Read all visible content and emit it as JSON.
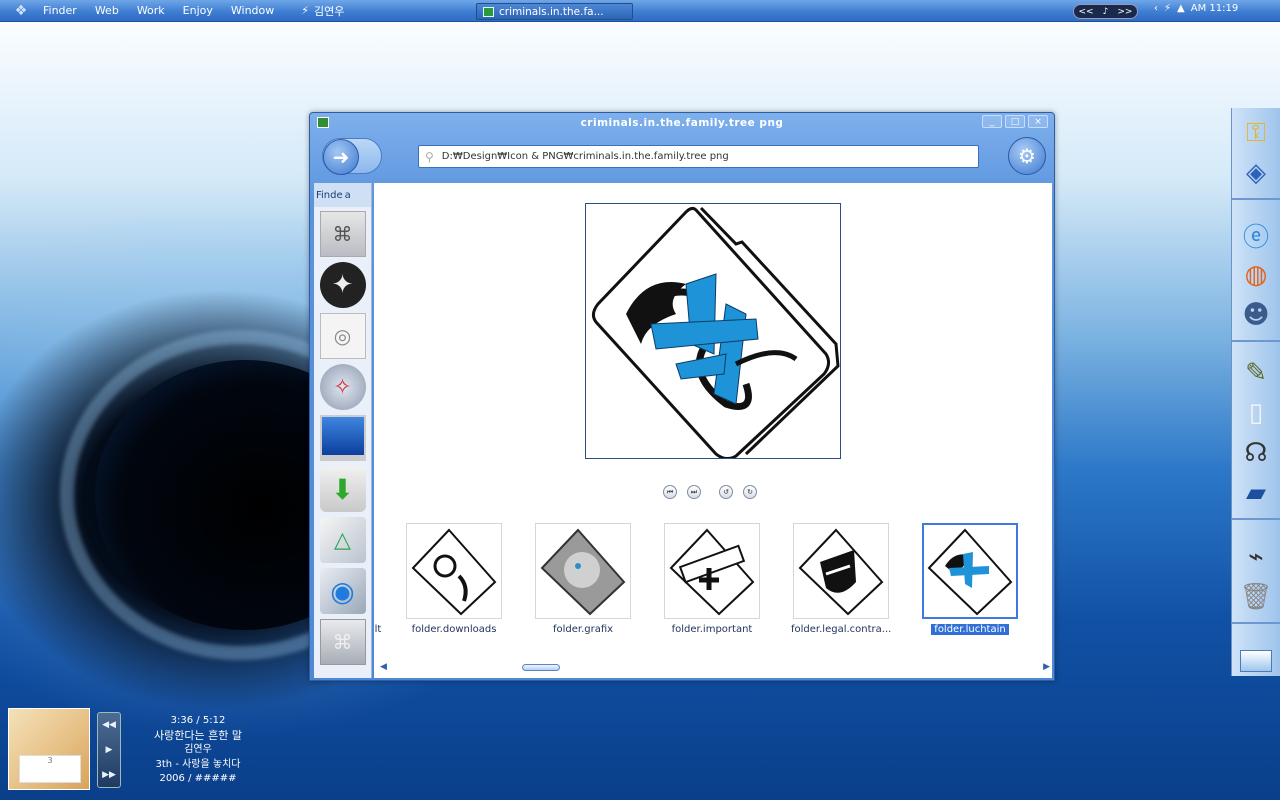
{
  "menubar": {
    "menus": [
      "Finder",
      "Web",
      "Work",
      "Enjoy",
      "Window"
    ],
    "user": "김연우",
    "task_button": "criminals.in.the.fa...",
    "media": {
      "prev": "<<",
      "note": "♪",
      "next": ">>"
    },
    "clock": "AM 11:19"
  },
  "window": {
    "title": "criminals.in.the.family.tree png",
    "controls": [
      "_",
      "□",
      "×"
    ],
    "path": "D:₩Design₩Icon & PNG₩criminals.in.the.family.tree png",
    "sidebar_tabs": [
      "Finde",
      "a"
    ],
    "sidebar_icons": [
      "apple-logo-icon",
      "film-reel-icon",
      "ipod-icon",
      "safari-compass-icon",
      "monitor-icon",
      "download-arrow-icon",
      "drawing-tablet-icon",
      "globe-icon",
      "apple-drive-icon"
    ],
    "nav_controls": [
      "⏮",
      "⏭",
      "↺",
      "↻"
    ],
    "thumbnails": [
      {
        "label": "lt",
        "partial": true
      },
      {
        "label": "folder.downloads"
      },
      {
        "label": "folder.grafix"
      },
      {
        "label": "folder.important"
      },
      {
        "label": "folder.legal.contra..."
      },
      {
        "label": "folder.luchtain",
        "selected": true
      }
    ]
  },
  "dock": {
    "sections": [
      [
        "keys-icon",
        "cube-icon"
      ],
      [
        "ie-browser-icon",
        "firefox-icon",
        "user-icon"
      ],
      [
        "pen-icon",
        "ipod-white-icon",
        "headphones-icon",
        "scanner-icon"
      ],
      [
        "usb-drive-icon",
        "trash-icon"
      ],
      [
        "desktop-preview-icon"
      ]
    ]
  },
  "player": {
    "time": "3:36 / 5:12",
    "song": "사랑한다는 흔한 말",
    "artist": "김연우",
    "album": "3th - 사랑을 놓치다",
    "year": "2006 / #####",
    "cover_text": "3"
  },
  "colors": {
    "menubar": "#3f7ed3",
    "window_chrome": "#5b93dd",
    "selection": "#2f6fd6",
    "accent_blue": "#1f8fd6"
  }
}
